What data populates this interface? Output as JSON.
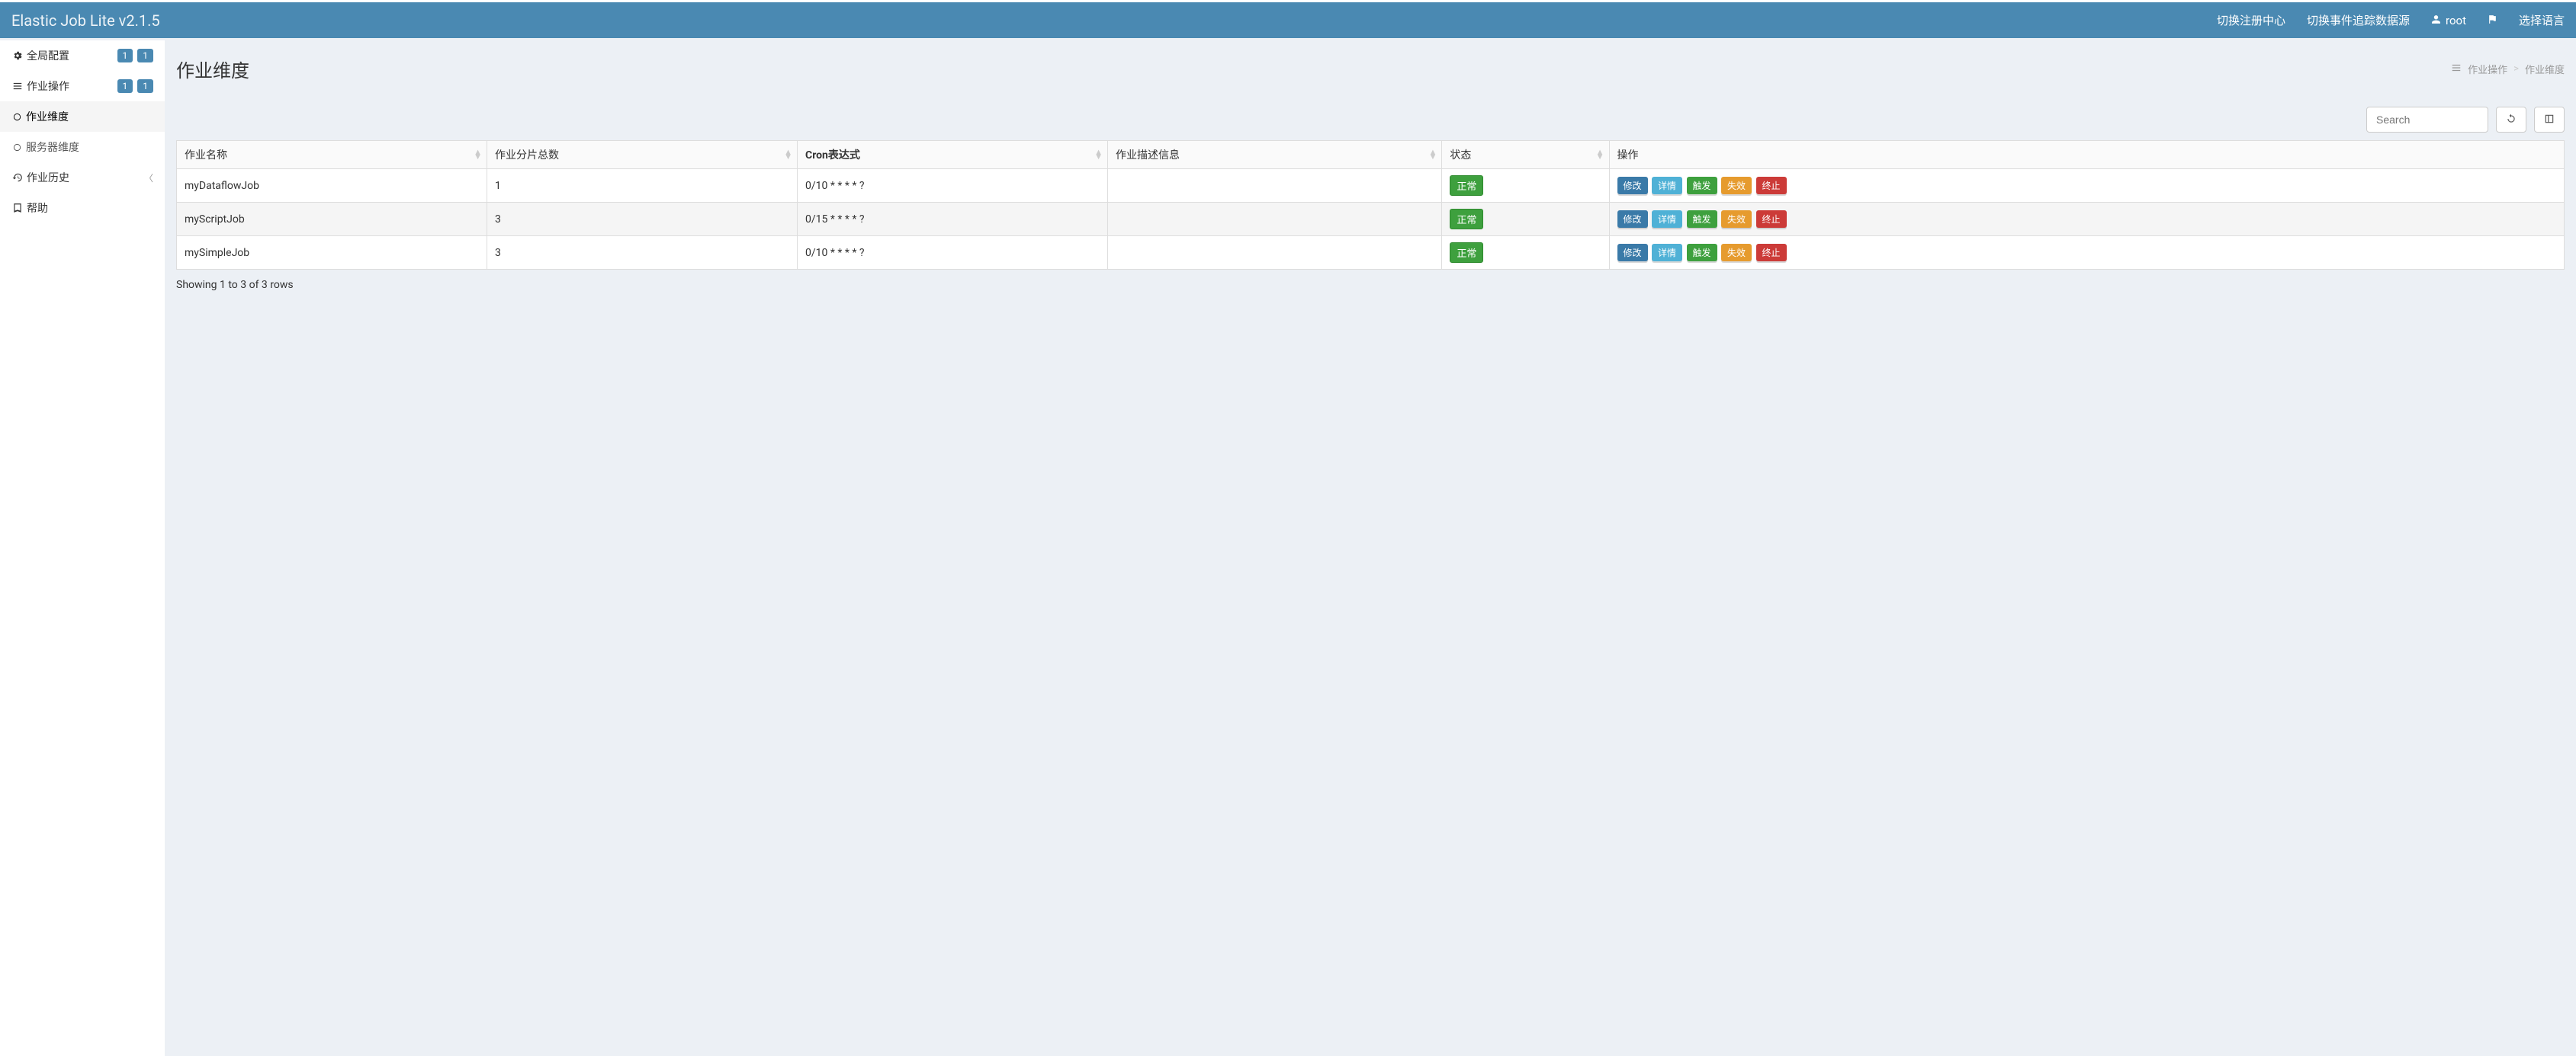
{
  "header": {
    "brand": "Elastic Job Lite v2.1.5",
    "nav": {
      "switch_registry": "切换注册中心",
      "switch_event_trace": "切换事件追踪数据源",
      "user": "root",
      "select_language": "选择语言"
    }
  },
  "sidebar": {
    "items": [
      {
        "label": "全局配置",
        "badges": [
          "1",
          "1"
        ]
      },
      {
        "label": "作业操作",
        "badges": [
          "1",
          "1"
        ]
      },
      {
        "label": "作业维度",
        "sub": true,
        "active": true
      },
      {
        "label": "服务器维度",
        "sub": true
      },
      {
        "label": "作业历史",
        "collapsible": true
      },
      {
        "label": "帮助"
      }
    ]
  },
  "page": {
    "title": "作业维度",
    "breadcrumb": [
      "作业操作",
      "作业维度"
    ]
  },
  "toolbar": {
    "search_placeholder": "Search"
  },
  "table": {
    "columns": [
      "作业名称",
      "作业分片总数",
      "Cron表达式",
      "作业描述信息",
      "状态",
      "操作"
    ],
    "rows": [
      {
        "name": "myDataflowJob",
        "shards": "1",
        "cron": "0/10 * * * * ?",
        "desc": "",
        "status": "正常"
      },
      {
        "name": "myScriptJob",
        "shards": "3",
        "cron": "0/15 * * * * ?",
        "desc": "",
        "status": "正常"
      },
      {
        "name": "mySimpleJob",
        "shards": "3",
        "cron": "0/10 * * * * ?",
        "desc": "",
        "status": "正常"
      }
    ],
    "actions": {
      "edit": "修改",
      "detail": "详情",
      "trigger": "触发",
      "disable": "失效",
      "shutdown": "终止"
    },
    "footer": "Showing 1 to 3 of 3 rows"
  }
}
